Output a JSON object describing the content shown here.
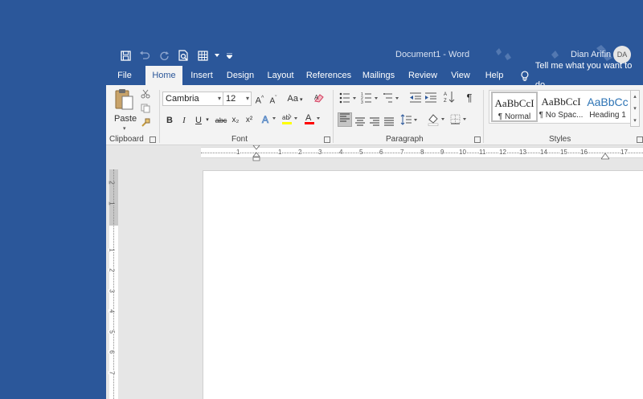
{
  "window": {
    "title": "Document1  -  Word",
    "user_name": "Dian Arifin",
    "avatar_initials": "DA"
  },
  "tabs": [
    "File",
    "Home",
    "Insert",
    "Design",
    "Layout",
    "References",
    "Mailings",
    "Review",
    "View",
    "Help"
  ],
  "active_tab": "Home",
  "tell_me": "Tell me what you want to do",
  "clipboard": {
    "paste_label": "Paste",
    "group_label": "Clipboard"
  },
  "font": {
    "family": "Cambria",
    "size": "12",
    "bold": "B",
    "italic": "I",
    "underline": "U",
    "strikethrough": "abc",
    "subscript": "x₂",
    "superscript": "x²",
    "change_case": "Aa",
    "grow": "A",
    "shrink": "A",
    "group_label": "Font"
  },
  "paragraph": {
    "group_label": "Paragraph"
  },
  "styles": {
    "items": [
      {
        "sample": "AaBbCcI",
        "name": "¶ Normal"
      },
      {
        "sample": "AaBbCcI",
        "name": "¶ No Spac..."
      },
      {
        "sample": "AaBbCc",
        "name": "Heading 1"
      }
    ],
    "group_label": "Styles"
  },
  "ruler": {
    "h_numbers": [
      "1",
      "1",
      "2",
      "3",
      "4",
      "5",
      "6",
      "7",
      "8",
      "9",
      "10",
      "11",
      "12",
      "13",
      "14",
      "15",
      "16",
      "17"
    ],
    "v_numbers": [
      "2",
      "1",
      "1",
      "2",
      "3",
      "4",
      "5",
      "6",
      "7"
    ]
  },
  "colors": {
    "brand": "#2b579a",
    "ribbon": "#f3f3f3",
    "highlight": "#ffff00",
    "font_color": "#ff0000"
  }
}
